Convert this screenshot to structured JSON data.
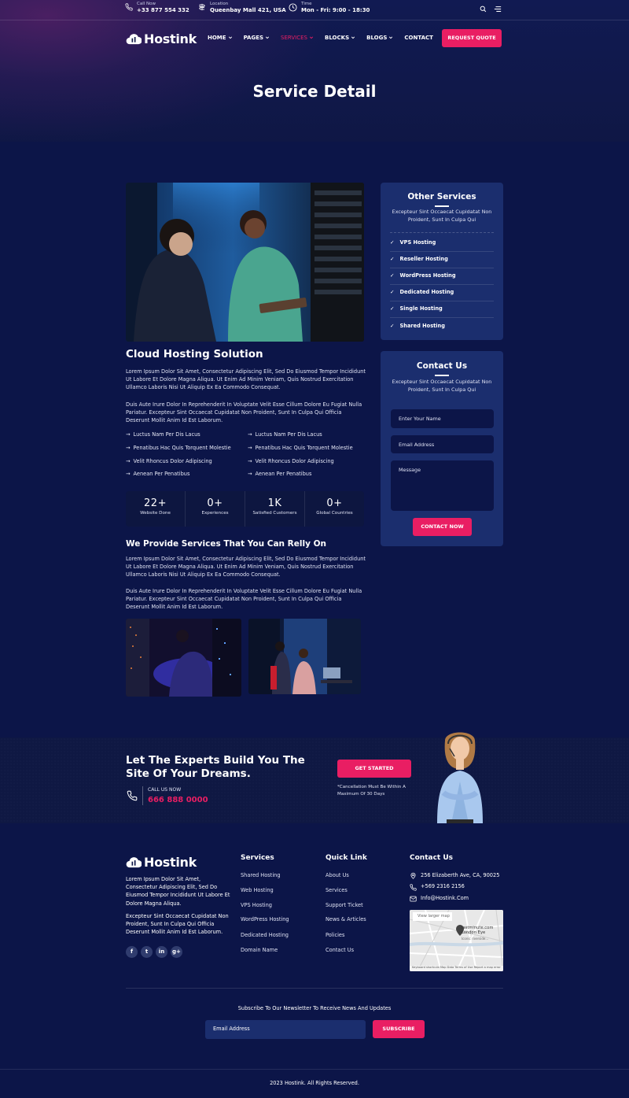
{
  "topbar": {
    "call_label": "Call Now",
    "call_value": "+33 877 554 332",
    "location_label": "Location",
    "location_value": "Queenbay Mall 421, USA",
    "time_label": "Time",
    "time_value": "Mon - Fri: 9:00 - 18:30"
  },
  "brand": {
    "name": "Hostink",
    "accent_color": "#e91e63",
    "bg_color": "#0c1548",
    "card_color": "#1b2e6e"
  },
  "nav": {
    "items": [
      {
        "label": "HOME"
      },
      {
        "label": "PAGES"
      },
      {
        "label": "SERVICES"
      },
      {
        "label": "BLOCKS"
      },
      {
        "label": "BLOGS"
      },
      {
        "label": "CONTACT"
      }
    ],
    "cta": "REQUEST QUOTE"
  },
  "page": {
    "title": "Service Detail"
  },
  "article": {
    "heading": "Cloud Hosting Solution",
    "para1": "Lorem Ipsum Dolor Sit Amet, Consectetur Adipiscing Elit, Sed Do Eiusmod Tempor Incididunt Ut Labore Et Dolore Magna Aliqua. Ut Enim Ad Minim Veniam, Quis Nostrud Exercitation Ullamco Laboris Nisi Ut Aliquip Ex Ea Commodo Consequat.",
    "para2": "Duis Aute Irure Dolor In Reprehenderit In Voluptate Velit Esse Cillum Dolore Eu Fugiat Nulla Pariatur. Excepteur Sint Occaecat Cupidatat Non Proident, Sunt In Culpa Qui Officia Deserunt Mollit Anim Id Est Laborum.",
    "bullets_left": [
      "Luctus Nam Per Dis Lacus",
      "Penatibus Hac Quis Torquent Molestie",
      "Velit Rhoncus Dolor Adipiscing",
      "Aenean Per Penatibus"
    ],
    "bullets_right": [
      "Luctus Nam Per Dis Lacus",
      "Penatibus Hac Quis Torquent Molestie",
      "Velit Rhoncus Dolor Adipiscing",
      "Aenean Per Penatibus"
    ],
    "stats": [
      {
        "value": "22+",
        "label": "Website Done"
      },
      {
        "value": "0+",
        "label": "Experiences"
      },
      {
        "value": "1K",
        "label": "Satisfied Customers"
      },
      {
        "value": "0+",
        "label": "Global Countries"
      }
    ],
    "heading2": "We Provide Services That You Can Relly On",
    "para3": "Lorem Ipsum Dolor Sit Amet, Consectetur Adipiscing Elit, Sed Do Eiusmod Tempor Incididunt Ut Labore Et Dolore Magna Aliqua. Ut Enim Ad Minim Veniam, Quis Nostrud Exercitation Ullamco Laboris Nisi Ut Aliquip Ex Ea Commodo Consequat.",
    "para4": "Duis Aute Irure Dolor In Reprehenderit In Voluptate Velit Esse Cillum Dolore Eu Fugiat Nulla Pariatur. Excepteur Sint Occaecat Cupidatat Non Proident, Sunt In Culpa Qui Officia Deserunt Mollit Anim Id Est Laborum."
  },
  "sidebar": {
    "services_title": "Other Services",
    "services_sub": "Excepteur Sint Occaecat Cupidatat Non Proident, Sunt In Culpa Qui",
    "services": [
      "VPS Hosting",
      "Reseller Hosting",
      "WordPress Hosting",
      "Dedicated Hosting",
      "Single Hosting",
      "Shared Hosting"
    ],
    "contact_title": "Contact Us",
    "contact_sub": "Excepteur Sint Occaecat Cupidatat Non Proident, Sunt In Culpa Qui",
    "name_placeholder": "Enter Your Name",
    "email_placeholder": "Email Address",
    "message_placeholder": "Message",
    "submit": "CONTACT NOW"
  },
  "cta": {
    "heading": "Let The Experts Build You The Site Of Your Dreams.",
    "call_label": "CALL US NOW",
    "phone": "666 888 0000",
    "button": "GET STARTED",
    "note": "*Cancellation Must Be Within A Maximum Of 30 Days"
  },
  "footer": {
    "about1": "Lorem Ipsum Dolor Sit Amet, Consectetur Adipiscing Elit, Sed Do Eiusmod Tempor Incididunt Ut Labore Et Dolore Magna Aliqua.",
    "about2": "Excepteur Sint Occaecat Cupidatat Non Proident, Sunt In Culpa Qui Officia Deserunt Mollit Anim Id Est Laborum.",
    "social": [
      "f",
      "t",
      "in",
      "g+"
    ],
    "services_title": "Services",
    "services": [
      "Shared Hosting",
      "Web Hosting",
      "VPS Hosting",
      "WordPress Hosting",
      "Dedicated Hosting",
      "Domain Name"
    ],
    "quick_title": "Quick Link",
    "quick": [
      "About Us",
      "Services",
      "Support Ticket",
      "News & Articles",
      "Policies",
      "Contact Us"
    ],
    "contact_title": "Contact Us",
    "address": "256 Elizaberth Ave, CA, 90025",
    "phone": "+569 2316 2156",
    "email": "Info@Hostink.Com",
    "map_link": "View larger map",
    "map_place": "lastminute.com London Eye",
    "map_place_sub": "Iconic riverside...",
    "map_footer": "Keyboard shortcuts  Map Data  Terms of Use  Report a map error",
    "newsletter_text": "Subscribe To Our Newsletter To Receive News And Updates",
    "newsletter_placeholder": "Email Address",
    "subscribe": "SUBSCRIBE",
    "copyright": "2023 Hostink. All Rights Reserved."
  }
}
